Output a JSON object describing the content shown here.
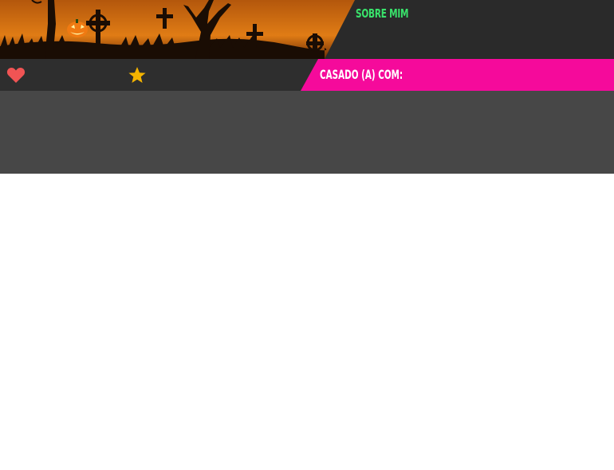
{
  "profile": {
    "about_label": "SOBRE MIM",
    "married_label": "CASADO (A) COM:"
  },
  "icons": {
    "like": "heart-icon",
    "favorite": "star-icon"
  },
  "colors": {
    "about_accent": "#39e36b",
    "married_bar": "#f50a9b",
    "heart": "#f05454",
    "star": "#f4b400",
    "panel": "#474747",
    "header_dark": "#2a2a2a"
  }
}
